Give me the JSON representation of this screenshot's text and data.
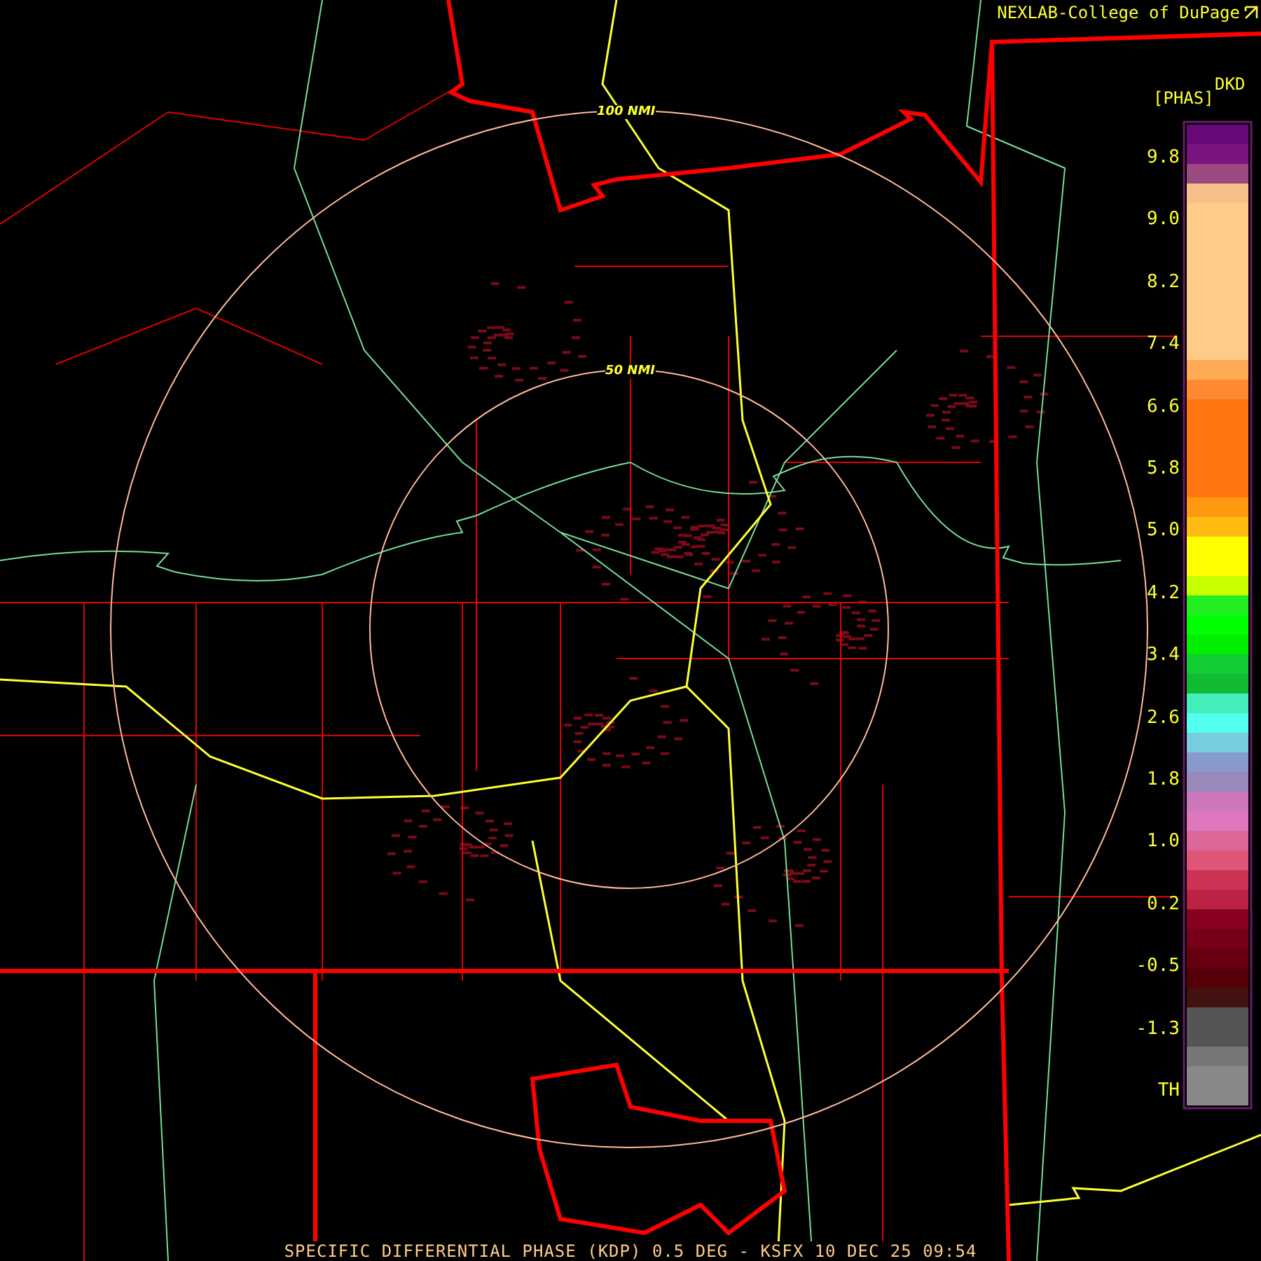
{
  "credit": "NEXLAB-College of DuPage",
  "map": {
    "rings": [
      {
        "label": "100 NMI"
      },
      {
        "label": "50 NMI"
      }
    ]
  },
  "legend": {
    "unit": "DKD",
    "units_bracket": "[PHAS]",
    "labels": [
      "9.8",
      "9.0",
      "8.2",
      "7.4",
      "6.6",
      "5.8",
      "5.0",
      "4.2",
      "3.4",
      "2.6",
      "1.8",
      "1.0",
      "0.2",
      "-0.5",
      "-1.3",
      "TH"
    ]
  },
  "caption": "SPECIFIC DIFFERENTIAL PHASE (KDP) 0.5 DEG - KSFX 10 DEC 25 09:54"
}
